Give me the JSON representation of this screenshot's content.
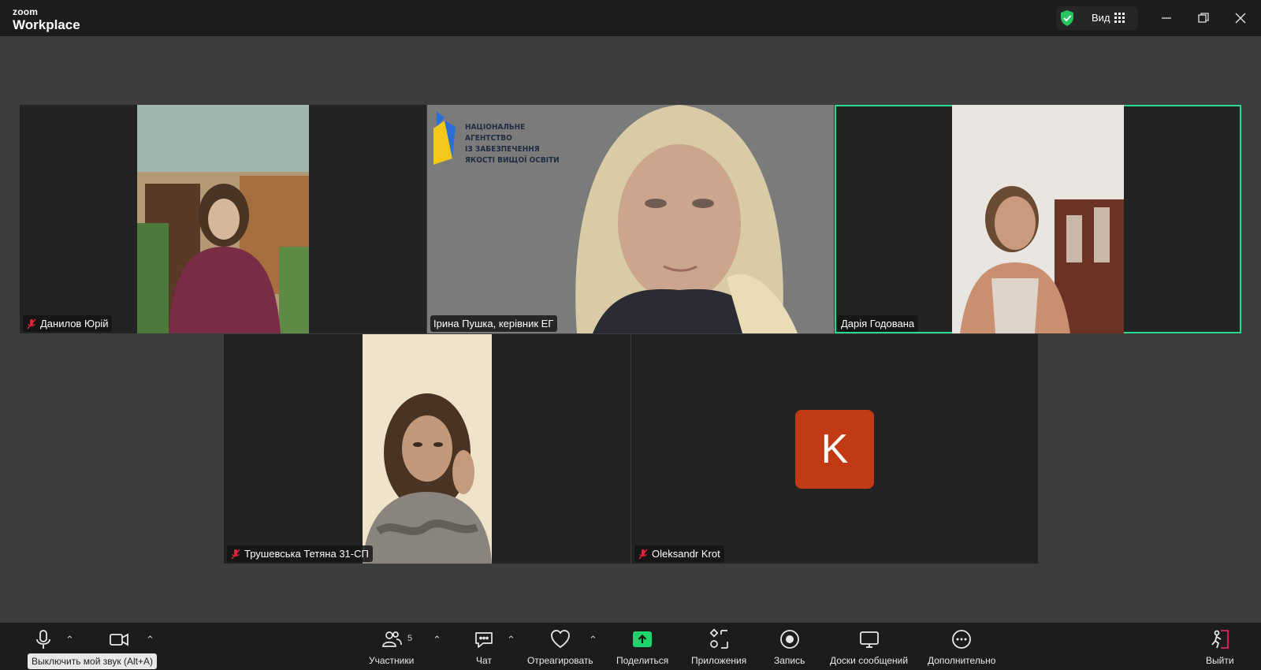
{
  "app": {
    "brand_top": "zoom",
    "brand_main": "Workplace",
    "view_label": "Вид"
  },
  "participants": [
    {
      "name": "Данилов Юрій",
      "muted": true
    },
    {
      "name": "Ірина Пушка, керівник ЕГ",
      "muted": false
    },
    {
      "name": "Дарія Годована",
      "muted": false,
      "active_speaker": true
    },
    {
      "name": "Трушевська Тетяна 31-СП",
      "muted": true
    },
    {
      "name": "Oleksandr Krot",
      "muted": true,
      "avatar_letter": "K",
      "avatar_color": "#c23a14"
    }
  ],
  "background_logo": {
    "lines": [
      "НАЦІОНАЛЬНЕ",
      "АГЕНТСТВО",
      "ІЗ ЗАБЕЗПЕЧЕННЯ",
      "ЯКОСТІ ВИЩОЇ ОСВІТИ"
    ]
  },
  "toolbar": {
    "participants_label": "Участники",
    "participants_count": "5",
    "chat_label": "Чат",
    "react_label": "Отреагировать",
    "share_label": "Поделиться",
    "apps_label": "Приложения",
    "record_label": "Запись",
    "whiteboards_label": "Доски сообщений",
    "more_label": "Дополнительно",
    "leave_label": "Выйти",
    "mute_tooltip": "Выключить мой звук (Alt+A)"
  },
  "colors": {
    "active_border": "#2bd98a",
    "share_green": "#1fd46a",
    "leave_red": "#e0245e"
  }
}
